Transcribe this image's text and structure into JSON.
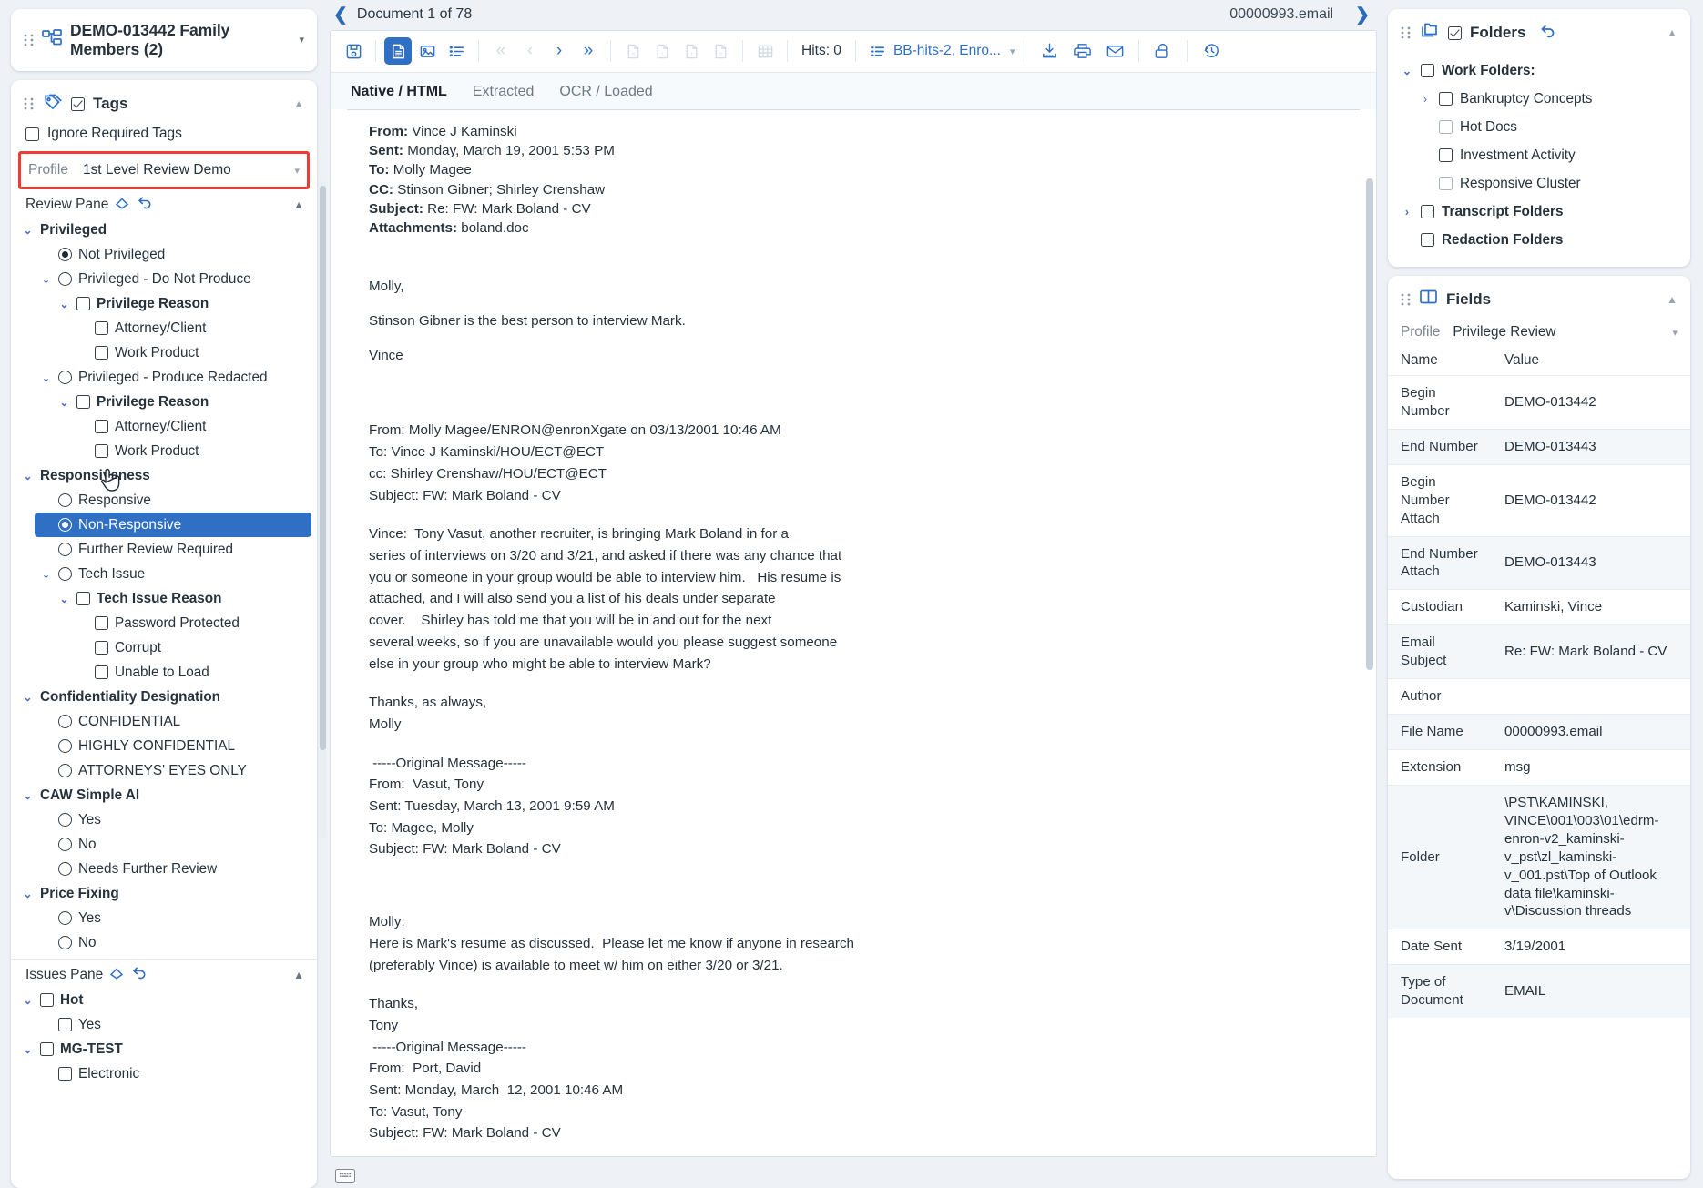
{
  "left": {
    "family": {
      "title": "DEMO-013442 Family Members (2)",
      "icon": "family-tree-icon",
      "caret": "▾"
    },
    "tags_panel": {
      "title": "Tags",
      "icon": "tags-icon",
      "collapse": "▲"
    },
    "ignore_required_tags": "Ignore Required Tags",
    "profile": {
      "label": "Profile",
      "value": "1st Level Review Demo",
      "caret": "▾"
    },
    "review_pane": {
      "label": "Review Pane",
      "clear_icon": "eraser-icon",
      "reset_icon": "undo-icon",
      "collapse": "▲"
    },
    "review_tree": [
      {
        "label": "Privileged",
        "type": "group",
        "indent": 0,
        "chev": "⌄",
        "bold": true
      },
      {
        "label": "Not Privileged",
        "type": "radio",
        "indent": 1,
        "checked": true
      },
      {
        "label": "Privileged - Do Not Produce",
        "type": "radio",
        "indent": 1,
        "chev": "⌄",
        "checked": false
      },
      {
        "label": "Privilege Reason",
        "type": "check",
        "indent": 2,
        "chev": "⌄",
        "bold": true
      },
      {
        "label": "Attorney/Client",
        "type": "check",
        "indent": 3
      },
      {
        "label": "Work Product",
        "type": "check",
        "indent": 3
      },
      {
        "label": "Privileged - Produce Redacted",
        "type": "radio",
        "indent": 1,
        "chev": "⌄",
        "checked": false
      },
      {
        "label": "Privilege Reason",
        "type": "check",
        "indent": 2,
        "chev": "⌄",
        "bold": true
      },
      {
        "label": "Attorney/Client",
        "type": "check",
        "indent": 3
      },
      {
        "label": "Work Product",
        "type": "check",
        "indent": 3
      },
      {
        "label": "Responsiveness",
        "type": "group",
        "indent": 0,
        "chev": "⌄",
        "bold": true
      },
      {
        "label": "Responsive",
        "type": "radio",
        "indent": 1
      },
      {
        "label": "Non-Responsive",
        "type": "radio",
        "indent": 1,
        "checked": true,
        "selected": true
      },
      {
        "label": "Further Review Required",
        "type": "radio",
        "indent": 1
      },
      {
        "label": "Tech Issue",
        "type": "radio",
        "indent": 1,
        "chev": "⌄"
      },
      {
        "label": "Tech Issue Reason",
        "type": "check",
        "indent": 2,
        "chev": "⌄",
        "bold": true
      },
      {
        "label": "Password Protected",
        "type": "check",
        "indent": 3
      },
      {
        "label": "Corrupt",
        "type": "check",
        "indent": 3
      },
      {
        "label": "Unable to Load",
        "type": "check",
        "indent": 3
      },
      {
        "label": "Confidentiality Designation",
        "type": "group",
        "indent": 0,
        "chev": "⌄",
        "bold": true
      },
      {
        "label": "CONFIDENTIAL",
        "type": "radio",
        "indent": 1
      },
      {
        "label": "HIGHLY CONFIDENTIAL",
        "type": "radio",
        "indent": 1
      },
      {
        "label": "ATTORNEYS' EYES ONLY",
        "type": "radio",
        "indent": 1
      },
      {
        "label": "CAW Simple AI",
        "type": "group",
        "indent": 0,
        "chev": "⌄",
        "bold": true
      },
      {
        "label": "Yes",
        "type": "radio",
        "indent": 1
      },
      {
        "label": "No",
        "type": "radio",
        "indent": 1
      },
      {
        "label": "Needs Further Review",
        "type": "radio",
        "indent": 1
      },
      {
        "label": "Price Fixing",
        "type": "group",
        "indent": 0,
        "chev": "⌄",
        "bold": true
      },
      {
        "label": "Yes",
        "type": "radio",
        "indent": 1
      },
      {
        "label": "No",
        "type": "radio",
        "indent": 1
      }
    ],
    "issues_pane": {
      "label": "Issues Pane",
      "clear_icon": "eraser-icon",
      "reset_icon": "undo-icon",
      "collapse": "▲"
    },
    "issues_tree": [
      {
        "label": "Hot",
        "type": "check",
        "indent": 0,
        "chev": "⌄",
        "bold": true
      },
      {
        "label": "Yes",
        "type": "check",
        "indent": 1
      },
      {
        "label": "MG-TEST",
        "type": "check",
        "indent": 0,
        "chev": "⌄",
        "bold": true
      },
      {
        "label": "Electronic",
        "type": "check",
        "indent": 1
      }
    ]
  },
  "center": {
    "doc_counter": "Document 1 of 78",
    "doc_file": "00000993.email",
    "back_icon": "❮",
    "forward_icon": "❯",
    "toolbar": {
      "save_icon": "save-disk-icon",
      "native_icon": "document-icon",
      "image_icon": "image-icon",
      "list_icon": "list-icon",
      "first_icon": "«",
      "prev_icon": "‹",
      "next_icon": "›",
      "last_icon": "»",
      "page_first_icon": "page-first-icon",
      "page_prev_icon": "page-prev-icon",
      "page_next_icon": "page-next-icon",
      "page_last_icon": "page-last-icon",
      "grid_icon": "grid-icon",
      "hits_label": "Hits: 0",
      "hits_list_icon": "hit-list-icon",
      "search_set": "BB-hits-2, Enro...",
      "search_caret": "▾",
      "download_icon": "download-icon",
      "print_icon": "print-icon",
      "email_icon": "envelope-icon",
      "unlock_icon": "unlock-icon",
      "history_icon": "history-icon"
    },
    "tabs": [
      {
        "label": "Native / HTML",
        "active": true
      },
      {
        "label": "Extracted",
        "active": false
      },
      {
        "label": "OCR / Loaded",
        "active": false
      }
    ],
    "email": {
      "header": [
        {
          "k": "From:",
          "v": "Vince J Kaminski"
        },
        {
          "k": "Sent:",
          "v": "Monday, March 19, 2001 5:53 PM"
        },
        {
          "k": "To:",
          "v": "Molly Magee"
        },
        {
          "k": "CC:",
          "v": "Stinson Gibner; Shirley Crenshaw"
        },
        {
          "k": "Subject:",
          "v": "Re: FW: Mark Boland - CV"
        },
        {
          "k": "Attachments:",
          "v": "boland.doc"
        }
      ],
      "greeting": "Molly,",
      "line1": "Stinson Gibner is the best person to interview Mark.",
      "signature": "Vince",
      "quoted1_header": "From: Molly Magee/ENRON@enronXgate on 03/13/2001 10:46 AM\nTo: Vince J Kaminski/HOU/ECT@ECT\ncc: Shirley Crenshaw/HOU/ECT@ECT\nSubject: FW: Mark Boland - CV",
      "quoted1_body": "Vince:  Tony Vasut, another recruiter, is bringing Mark Boland in for a\nseries of interviews on 3/20 and 3/21, and asked if there was any chance that\nyou or someone in your group would be able to interview him.   His resume is\nattached, and I will also send you a list of his deals under separate\ncover.    Shirley has told me that you will be in and out for the next\nseveral weeks, so if you are unavailable would you please suggest someone\nelse in your group who might be able to interview Mark?",
      "quoted1_sign": "Thanks, as always,\nMolly",
      "quoted2_header": " -----Original Message-----\nFrom:  Vasut, Tony\nSent: Tuesday, March 13, 2001 9:59 AM\nTo: Magee, Molly\nSubject: FW: Mark Boland - CV",
      "quoted2_body": "Molly:\nHere is Mark's resume as discussed.  Please let me know if anyone in research\n(preferably Vince) is available to meet w/ him on either 3/20 or 3/21.",
      "quoted2_sign": "Thanks,\nTony",
      "quoted3_header": " -----Original Message-----\nFrom:  Port, David\nSent: Monday, March  12, 2001 10:46 AM\nTo: Vasut, Tony\nSubject: FW: Mark Boland - CV"
    },
    "status_bar": {
      "keyboard_icon": "keyboard-icon"
    }
  },
  "right": {
    "folders_panel": {
      "title": "Folders",
      "icon": "folders-icon",
      "reset_icon": "undo-icon",
      "collapse": "▲",
      "checked": true
    },
    "folders_tree": [
      {
        "label": "Work Folders:",
        "indent": 0,
        "chev": "⌄",
        "bold": true,
        "light": false
      },
      {
        "label": "Bankruptcy Concepts",
        "indent": 1,
        "chev": "›",
        "bold": false,
        "light": false
      },
      {
        "label": "Hot Docs",
        "indent": 1,
        "light": true
      },
      {
        "label": "Investment Activity",
        "indent": 1,
        "light": false
      },
      {
        "label": "Responsive Cluster",
        "indent": 1,
        "light": true
      },
      {
        "label": "Transcript Folders",
        "indent": 0,
        "chev": "›",
        "bold": true
      },
      {
        "label": "Redaction Folders",
        "indent": 0,
        "bold": true
      }
    ],
    "fields_panel": {
      "title": "Fields",
      "icon": "columns-icon",
      "collapse": "▲"
    },
    "fields_profile": {
      "label": "Profile",
      "value": "Privilege Review",
      "caret": "▾"
    },
    "fields_columns": {
      "name": "Name",
      "value": "Value"
    },
    "fields_rows": [
      {
        "name": "Begin Number",
        "value": "DEMO-013442"
      },
      {
        "name": "End Number",
        "value": "DEMO-013443"
      },
      {
        "name": "Begin Number Attach",
        "value": "DEMO-013442"
      },
      {
        "name": "End Number Attach",
        "value": "DEMO-013443"
      },
      {
        "name": "Custodian",
        "value": "Kaminski, Vince"
      },
      {
        "name": "Email Subject",
        "value": "Re: FW: Mark Boland - CV"
      },
      {
        "name": "Author",
        "value": ""
      },
      {
        "name": "File Name",
        "value": "00000993.email"
      },
      {
        "name": "Extension",
        "value": "msg"
      },
      {
        "name": "Folder",
        "value": "\\PST\\KAMINSKI, VINCE\\001\\003\\01\\edrm-enron-v2_kaminski-v_pst\\zl_kaminski-v_001.pst\\Top of Outlook data file\\kaminski-v\\Discussion threads"
      },
      {
        "name": "Date Sent",
        "value": "3/19/2001"
      },
      {
        "name": "Type of Document",
        "value": "EMAIL"
      }
    ]
  },
  "colors": {
    "accent_blue": "#2f6fc4",
    "chevron_blue": "#4a6fd4",
    "highlight_red": "#ef3b36",
    "page_bg": "#eef2f6"
  }
}
